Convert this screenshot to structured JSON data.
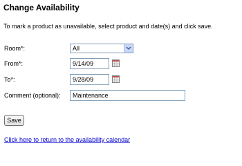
{
  "page": {
    "title": "Change Availability",
    "instructions": "To mark a product as unavailable, select product and date(s) and click save."
  },
  "form": {
    "room_label": "Room*:",
    "room_value": "All",
    "from_label": "From*:",
    "from_value": "9/14/09",
    "to_label": "To*:",
    "to_value": "9/28/09",
    "comment_label": "Comment (optional):",
    "comment_value": "Maintenance"
  },
  "actions": {
    "save_label": "Save",
    "return_link": "Click here to return to the availability calendar"
  },
  "icons": {
    "dropdown": "chevron-down-icon",
    "date_picker": "calendar-icon"
  },
  "colors": {
    "link": "#0000cc",
    "input_border": "#7f9db9",
    "dropdown_button": "#c9d8f8"
  }
}
